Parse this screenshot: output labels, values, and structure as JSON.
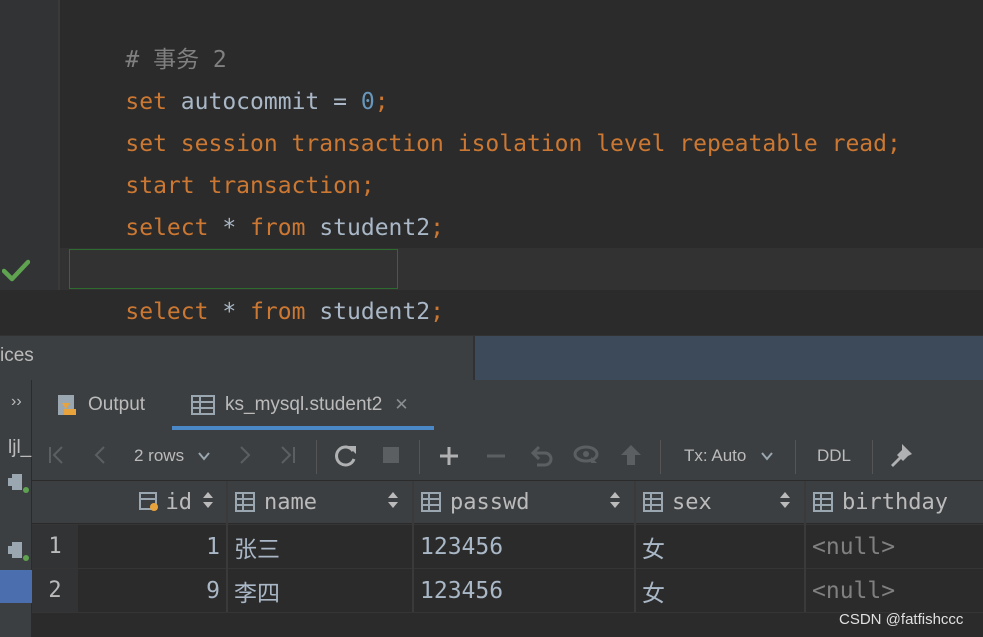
{
  "editor": {
    "lines": [
      {
        "comment": "# 事务 2"
      },
      {
        "kw1": "set",
        "name": "autocommit",
        "eq": "=",
        "num": "0",
        "semi": ";"
      },
      {
        "text": "set session transaction isolation level repeatable read;"
      },
      {
        "text": "start transaction;"
      },
      {
        "kw1": "select",
        "star": "*",
        "kw2": "from",
        "table": "student2",
        "semi": ";"
      },
      {
        "kw1": "select",
        "star": "*",
        "kw2": "from",
        "table": "student2",
        "semi": ";"
      }
    ]
  },
  "services": {
    "title": "ices"
  },
  "left_panel": {
    "expand": "››",
    "label": "ljl_"
  },
  "tabs": [
    {
      "label": "Output",
      "icon": "output-icon"
    },
    {
      "label": "ks_mysql.student2",
      "icon": "table-icon",
      "close": "✕"
    }
  ],
  "toolbar": {
    "rows_label": "2 rows",
    "tx_label": "Tx: Auto",
    "ddl_label": "DDL"
  },
  "grid": {
    "columns": [
      "id",
      "name",
      "passwd",
      "sex",
      "birthday"
    ],
    "rows": [
      {
        "num": "1",
        "id": "1",
        "name": "张三",
        "passwd": "123456",
        "sex": "女",
        "birthday": "<null>"
      },
      {
        "num": "2",
        "id": "9",
        "name": "李四",
        "passwd": "123456",
        "sex": "女",
        "birthday": "<null>"
      }
    ]
  },
  "watermark": "CSDN @fatfishccc",
  "colors": {
    "keyword": "#cc7832",
    "number": "#6897bb",
    "comment": "#808080",
    "text": "#a9b7c6",
    "accent": "#4a88c7",
    "success": "#5fa350"
  }
}
